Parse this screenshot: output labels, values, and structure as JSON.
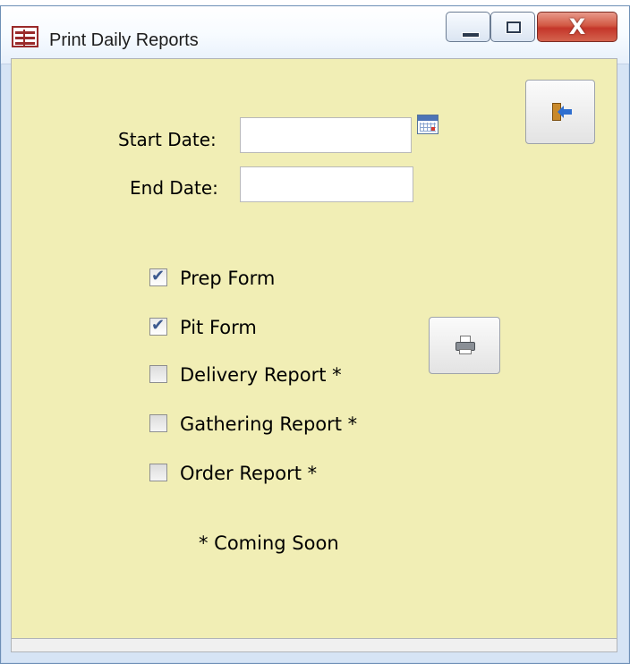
{
  "window": {
    "title": "Print Daily Reports",
    "controls": {
      "minimize_icon": "minimize-icon",
      "maximize_icon": "maximize-icon",
      "close_symbol": "X"
    }
  },
  "form": {
    "background_color": "#f1eeb5",
    "start_date": {
      "label": "Start Date:",
      "value": ""
    },
    "end_date": {
      "label": "End Date:",
      "value": ""
    },
    "calendar_icon": "calendar-icon",
    "exit_icon": "exit-door-icon",
    "print_icon": "printer-icon",
    "reports": [
      {
        "label": "Prep Form",
        "checked": true
      },
      {
        "label": "Pit Form",
        "checked": true
      },
      {
        "label": "Delivery Report *",
        "checked": false
      },
      {
        "label": "Gathering Report *",
        "checked": false
      },
      {
        "label": "Order Report  *",
        "checked": false
      }
    ],
    "note": "* Coming Soon"
  }
}
